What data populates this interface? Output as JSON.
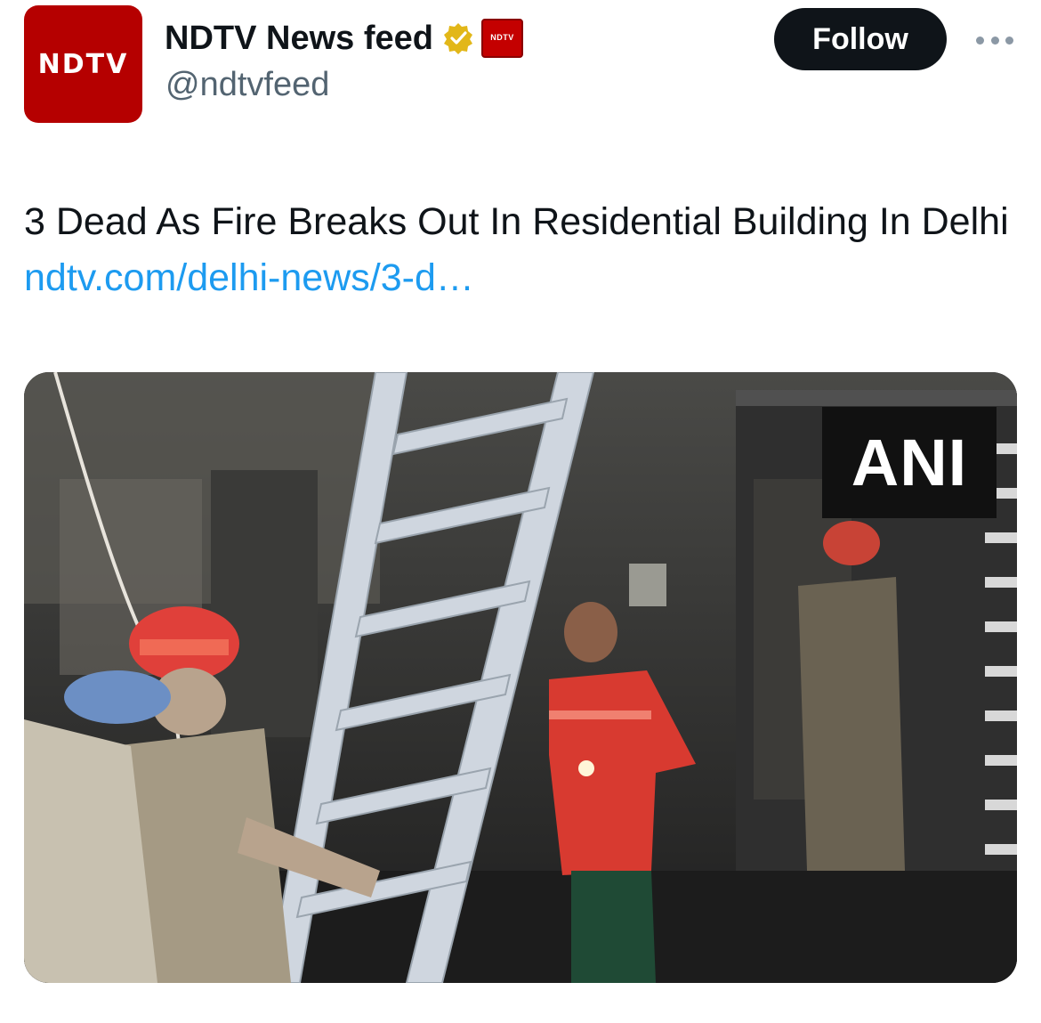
{
  "account": {
    "avatar_text": "NDTV",
    "display_name": "NDTV News feed",
    "handle": "@ndtvfeed",
    "affiliate_badge_text": "NDTV",
    "verified": true
  },
  "actions": {
    "follow_label": "Follow"
  },
  "tweet": {
    "text": "3 Dead As Fire Breaks Out In Residential Building In Delhi",
    "link_text": "ndtv.com/delhi-news/3-d…"
  },
  "media": {
    "watermark": "ANI"
  },
  "colors": {
    "brand": "#b50000",
    "link": "#1d9bf0",
    "button": "#0f1419",
    "verified_gold": "#e2b719"
  }
}
